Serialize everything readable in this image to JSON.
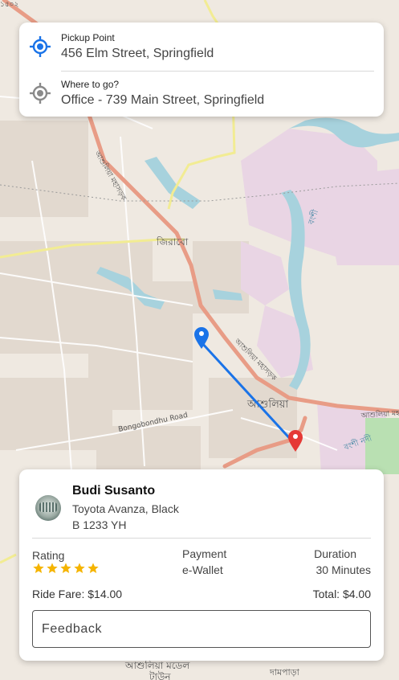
{
  "route": {
    "pickup_label": "Pickup Point",
    "pickup_value": "456 Elm Street, Springfield",
    "destination_label": "Where to go?",
    "destination_value": "Office - 739 Main Street, Springfield"
  },
  "map": {
    "labels": {
      "jirabo": "জিরাবো",
      "ashulia": "আশুলিয়া",
      "bongobondhu_road": "Bongobondhu Road",
      "ashulia_highway_1": "আশুলিয়া মহাসড়ক",
      "ashulia_highway_2": "আশুলিয়া মহাসড়ক",
      "ashulia_right": "আশুলিয়া মহা",
      "ashulia_model": "আশুলিয়া মডেল",
      "town": "টাউন",
      "dampara": "দামপাড়া",
      "river_right": "বংশী",
      "river_top": "বংশী নদী",
      "corner": "১৫০২"
    },
    "route_color": "#1a73e8",
    "pickup_pin_color": "#1a73e8",
    "destination_pin_color": "#e53935"
  },
  "driver": {
    "name": "Budi Susanto",
    "car": "Toyota Avanza, Black",
    "plate": "B 1233 YH",
    "rating_label": "Rating",
    "rating_value": 5,
    "rating_max": 5,
    "payment_label": "Payment",
    "payment_value": "e-Wallet",
    "duration_label": "Duration",
    "duration_value": "30 Minutes",
    "fare": "Ride Fare: $14.00",
    "total": "Total: $4.00",
    "feedback_placeholder": "Feedback"
  },
  "colors": {
    "star": "#f5b400",
    "target_active": "#1a73e8",
    "target_inactive": "#8a8a8a"
  }
}
